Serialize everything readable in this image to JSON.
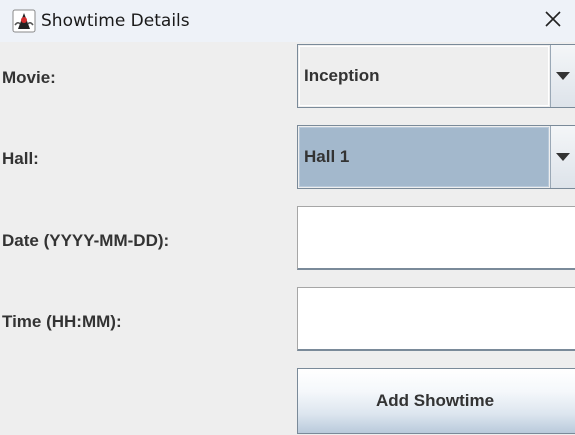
{
  "window": {
    "title": "Showtime Details",
    "app_icon": "java-duke-icon",
    "close_icon": "close-icon"
  },
  "form": {
    "movie": {
      "label": "Movie:",
      "selected": "Inception"
    },
    "hall": {
      "label": "Hall:",
      "selected": "Hall 1"
    },
    "date": {
      "label": "Date (YYYY-MM-DD):",
      "value": ""
    },
    "time": {
      "label": "Time (HH:MM):",
      "value": ""
    },
    "submit_label": "Add Showtime"
  },
  "colors": {
    "selected_combo_bg": "#a3b8cc",
    "window_bg": "#eeeeee",
    "titlebar_bg": "#eef2f8"
  }
}
